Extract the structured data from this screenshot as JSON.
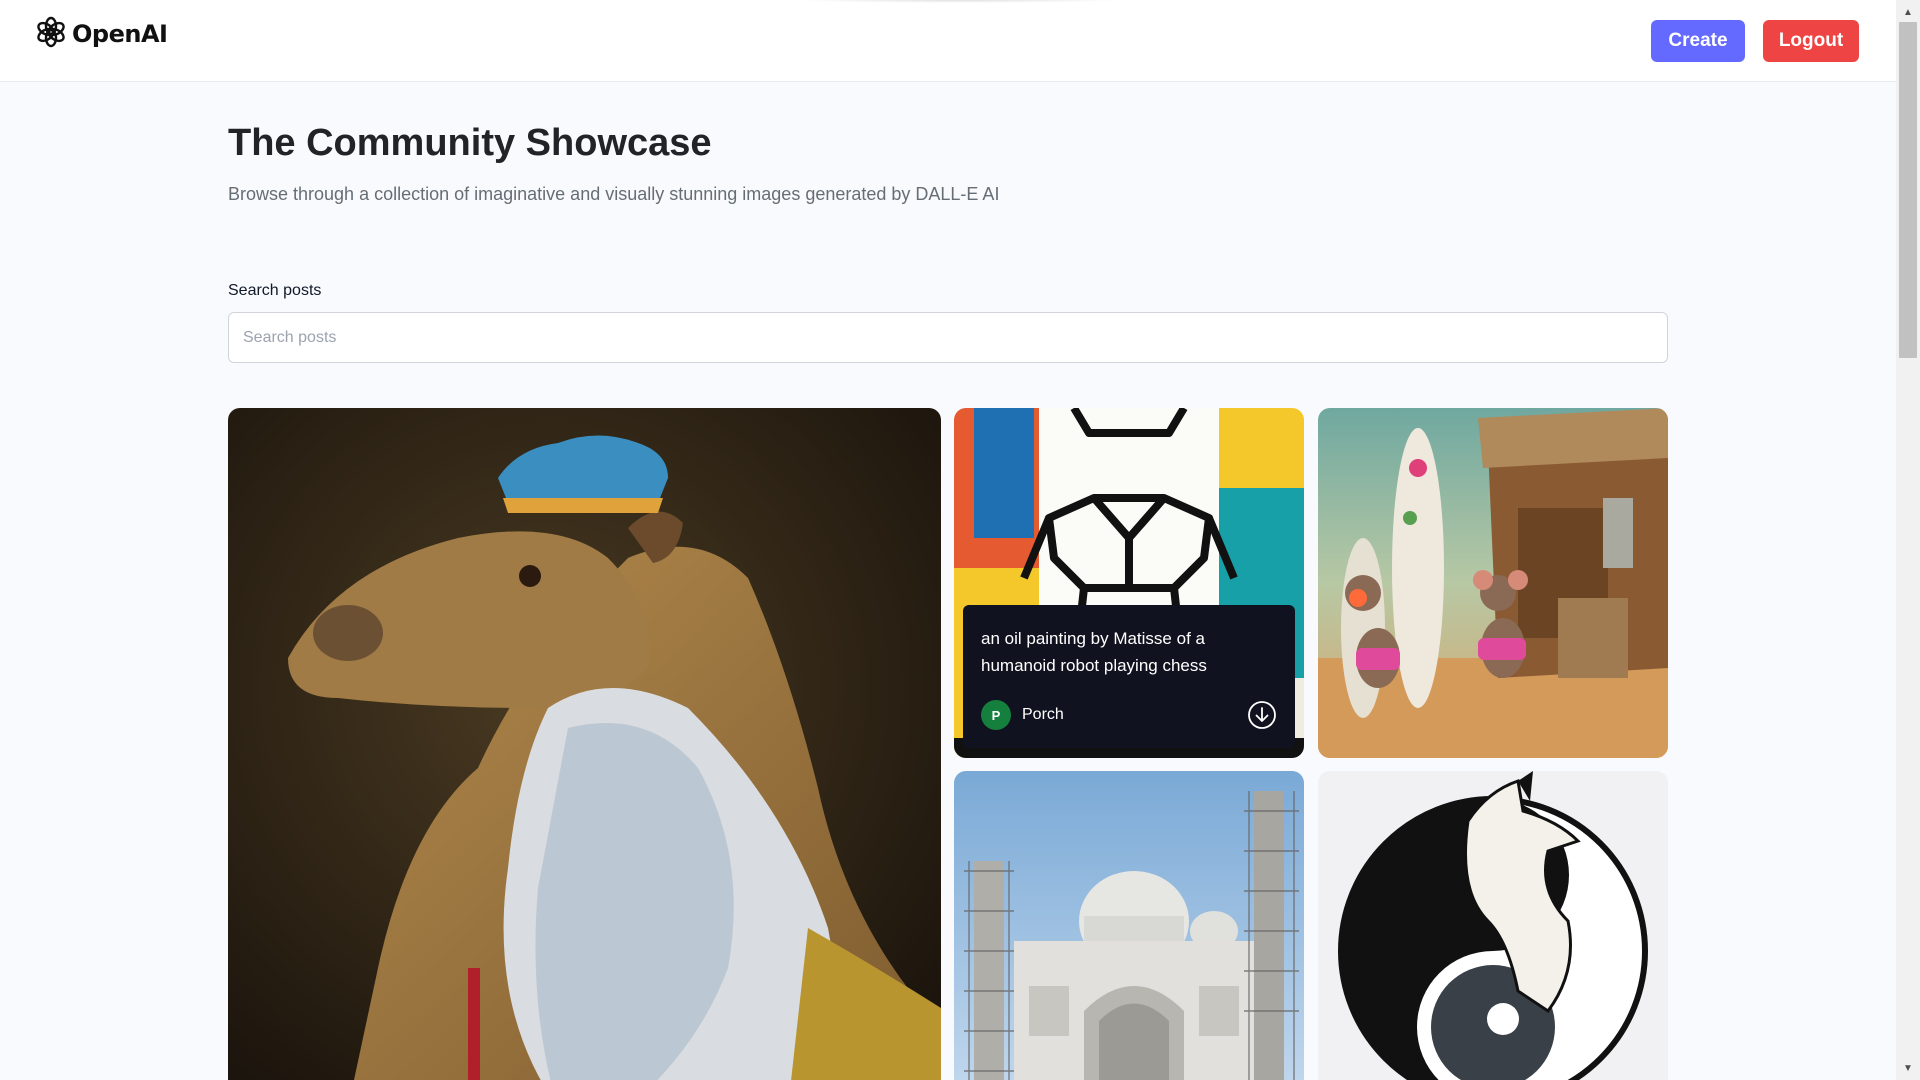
{
  "header": {
    "logo_text": "OpenAI",
    "create_label": "Create",
    "logout_label": "Logout"
  },
  "main": {
    "title": "The Community Showcase",
    "subtitle": "Browse through a collection of imaginative and visually stunning images generated by DALL-E AI"
  },
  "search": {
    "label": "Search posts",
    "placeholder": "Search posts",
    "value": ""
  },
  "posts": [
    {
      "image": "crowned capybara portrait painting"
    },
    {
      "image": "matisse style humanoid robot painting",
      "prompt": "an oil painting by Matisse of a humanoid robot playing chess",
      "author": "Porch",
      "avatar_letter": "P",
      "avatar_color": "#15803d"
    },
    {
      "image": "mice with surfboards diorama"
    },
    {
      "image": "taj mahal under scaffolding"
    },
    {
      "image": "yin yang wolf"
    }
  ],
  "colors": {
    "create": "#6469ff",
    "logout": "#ef4444",
    "overlay": "#10131f"
  },
  "icons": {
    "logo": "openai-logo-icon",
    "download": "download-icon"
  }
}
